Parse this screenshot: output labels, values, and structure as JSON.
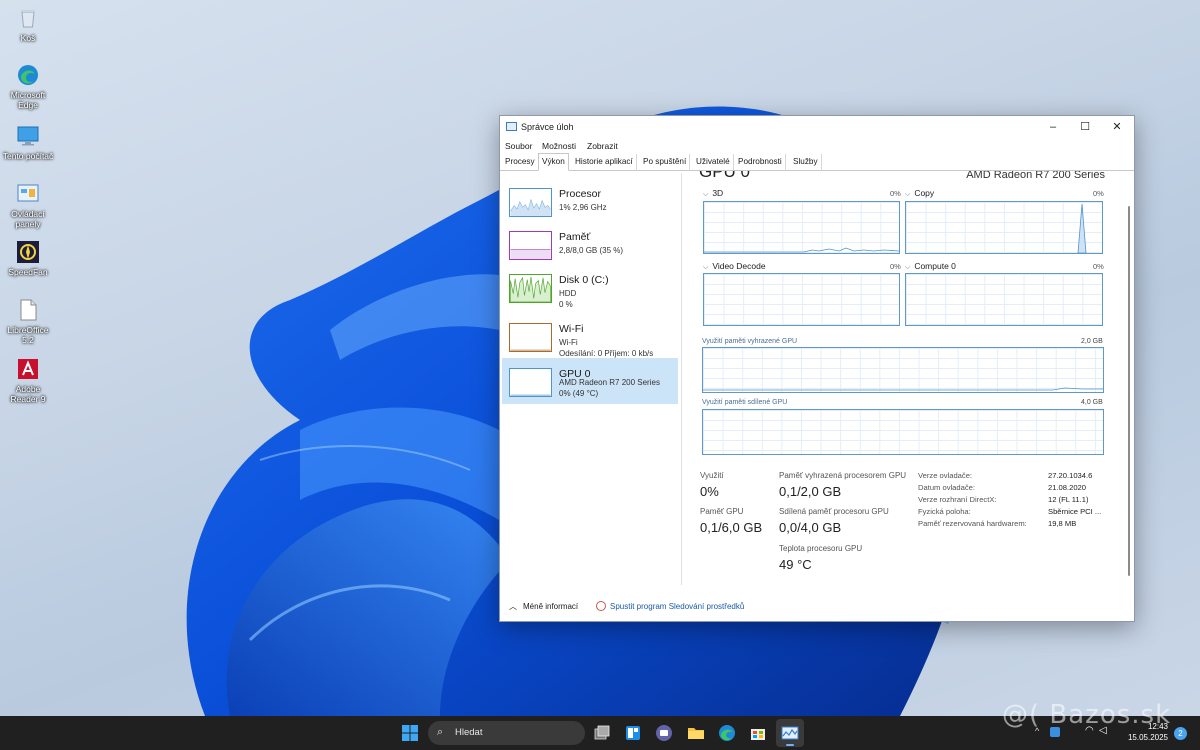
{
  "desktop": {
    "icons": [
      {
        "label": "Koš",
        "icon": "recycle-bin-icon"
      },
      {
        "label": "Microsoft Edge",
        "icon": "edge-icon"
      },
      {
        "label": "Tento počítač",
        "icon": "computer-icon"
      },
      {
        "label": "Ovládací panely",
        "icon": "control-panel-icon"
      },
      {
        "label": "SpeedFan",
        "icon": "speedfan-icon"
      },
      {
        "label": "LibreOffice 5.2",
        "icon": "libreoffice-icon"
      },
      {
        "label": "Adobe Reader 9",
        "icon": "adobe-reader-icon"
      }
    ]
  },
  "window": {
    "title": "Správce úloh",
    "controls": {
      "minimize": "–",
      "maximize": "☐",
      "close": "✕"
    },
    "menu": [
      "Soubor",
      "Možnosti",
      "Zobrazit"
    ],
    "tabs": [
      "Procesy",
      "Výkon",
      "Historie aplikací",
      "Po spuštění",
      "Uživatelé",
      "Podrobnosti",
      "Služby"
    ],
    "active_tab": "Výkon",
    "resources": [
      {
        "name": "Procesor",
        "line1": "1% 2,96 GHz",
        "line2": "",
        "color": "#4f94cd"
      },
      {
        "name": "Paměť",
        "line1": "2,8/8,0 GB (35 %)",
        "line2": "",
        "color": "#9b3cbc"
      },
      {
        "name": "Disk 0 (C:)",
        "line1": "HDD",
        "line2": "0 %",
        "color": "#4fa52b"
      },
      {
        "name": "Wi-Fi",
        "line1": "Wi-Fi",
        "line2": "Odesílání: 0 Příjem: 0 kb/s",
        "color": "#a86d2c"
      },
      {
        "name": "GPU 0",
        "line1": "AMD Radeon R7 200 Series",
        "line2": "0% (49 °C)",
        "color": "#4f94cd"
      }
    ],
    "selected_resource": "GPU 0",
    "main": {
      "title": "GPU 0",
      "model": "AMD Radeon R7 200 Series",
      "engines": [
        {
          "label": "3D",
          "percent": "0%"
        },
        {
          "label": "Copy",
          "percent": "0%"
        },
        {
          "label": "Video Decode",
          "percent": "0%"
        },
        {
          "label": "Compute 0",
          "percent": "0%"
        }
      ],
      "dedicated_mem_label": "Využití paměti vyhrazené GPU",
      "dedicated_mem_max": "2,0 GB",
      "shared_mem_label": "Využití paměti sdílené GPU",
      "shared_mem_max": "4,0 GB",
      "stats": {
        "utilization_label": "Využití",
        "utilization_value": "0%",
        "dedicated_label": "Paměť vyhrazená procesorem GPU",
        "dedicated_value": "0,1/2,0 GB",
        "gpu_mem_label": "Paměť GPU",
        "gpu_mem_value": "0,1/6,0 GB",
        "shared_label": "Sdílená paměť procesoru GPU",
        "shared_value": "0,0/4,0 GB",
        "temp_label": "Teplota procesoru GPU",
        "temp_value": "49 °C"
      },
      "properties": [
        {
          "key": "Verze ovladače:",
          "value": "27.20.1034.6"
        },
        {
          "key": "Datum ovladače:",
          "value": "21.08.2020"
        },
        {
          "key": "Verze rozhraní DirectX:",
          "value": "12 (FL 11.1)"
        },
        {
          "key": "Fyzická poloha:",
          "value": "Sběrnice PCI ..."
        },
        {
          "key": "Paměť rezervovaná hardwarem:",
          "value": "19,8 MB"
        }
      ]
    },
    "footer": {
      "less_info": "Méně informací",
      "open_monitor": "Spustit program Sledování prostředků"
    }
  },
  "taskbar": {
    "search_placeholder": "Hledat",
    "time": "12:43",
    "date": "15.05.2025",
    "notification_count": "2"
  },
  "watermark": "@( Bazos.sk"
}
